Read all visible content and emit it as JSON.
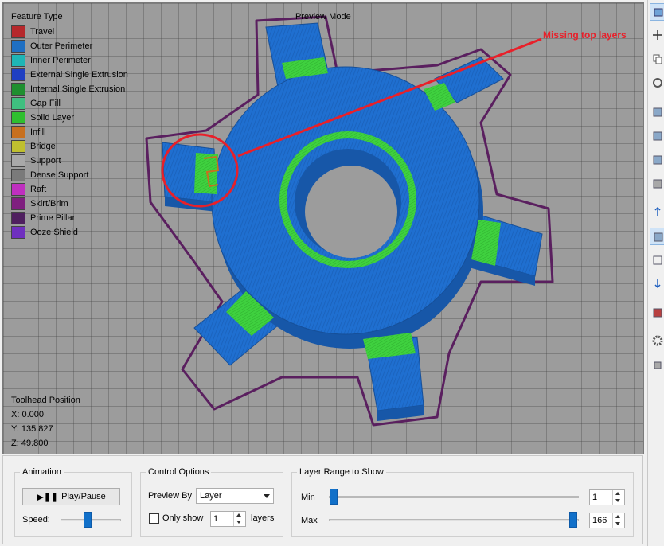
{
  "legend": {
    "title": "Feature Type",
    "items": [
      {
        "label": "Travel",
        "color": "#b6282c"
      },
      {
        "label": "Outer Perimeter",
        "color": "#1f6fc2"
      },
      {
        "label": "Inner Perimeter",
        "color": "#1fb5b5"
      },
      {
        "label": "External Single Extrusion",
        "color": "#1f3fc2"
      },
      {
        "label": "Internal Single Extrusion",
        "color": "#1f8f2f"
      },
      {
        "label": "Gap Fill",
        "color": "#3fbf7f"
      },
      {
        "label": "Solid Layer",
        "color": "#2fbf2f"
      },
      {
        "label": "Infill",
        "color": "#c8701f"
      },
      {
        "label": "Bridge",
        "color": "#bfbf2f"
      },
      {
        "label": "Support",
        "color": "#a8a8a8"
      },
      {
        "label": "Dense Support",
        "color": "#7a7a7a"
      },
      {
        "label": "Raft",
        "color": "#bf2fbf"
      },
      {
        "label": "Skirt/Brim",
        "color": "#7f1f7f"
      },
      {
        "label": "Prime Pillar",
        "color": "#4f1f5f"
      },
      {
        "label": "Ooze Shield",
        "color": "#6f2fbf"
      }
    ]
  },
  "viewport": {
    "preview_mode_label": "Preview Mode",
    "annotation": "Missing top layers",
    "toolhead": {
      "title": "Toolhead Position",
      "x": "X: 0.000",
      "y": "Y: 135.827",
      "z": "Z: 49.800"
    },
    "colors": {
      "part": "#1f6fd0",
      "part_dark": "#1757a8",
      "solid": "#3fd13f",
      "skirt": "#5a1f5f",
      "annotation": "#e8202a"
    }
  },
  "animation": {
    "group_label": "Animation",
    "play_label": "Play/Pause",
    "speed_label": "Speed:"
  },
  "control_options": {
    "group_label": "Control Options",
    "preview_by_label": "Preview By",
    "preview_by_value": "Layer",
    "only_show_label": "Only show",
    "only_show_value": "1",
    "layers_label": "layers"
  },
  "layer_range": {
    "group_label": "Layer Range to Show",
    "min_label": "Min",
    "min_value": "1",
    "max_label": "Max",
    "max_value": "166"
  },
  "toolbar": {
    "icons": [
      "view-icon",
      "move-icon",
      "copy-icon",
      "rotate-icon",
      "cube-front-icon",
      "cube-side-icon",
      "cube-top-icon",
      "cube-iso-icon",
      "axis-icon",
      "solid-view-icon",
      "wireframe-icon",
      "arrow-down-icon",
      "color-cube-icon",
      "settings-icon",
      "small-cube-icon"
    ]
  }
}
